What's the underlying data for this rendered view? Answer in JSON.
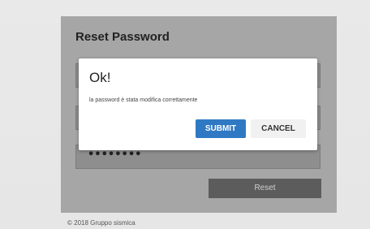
{
  "reset_form": {
    "title": "Reset Password",
    "password_mask": "••••••••",
    "reset_button_label": "Reset"
  },
  "footer": {
    "copyright": "© 2018 Gruppo sismica"
  },
  "dialog": {
    "title": "Ok!",
    "message": "la password è stata modifica correttamente",
    "submit_label": "SUBMIT",
    "cancel_label": "CANCEL"
  },
  "colors": {
    "submit_button": "#2f79c4",
    "reset_button": "#5c5c5c",
    "overlay_card": "#a6a6a6"
  }
}
